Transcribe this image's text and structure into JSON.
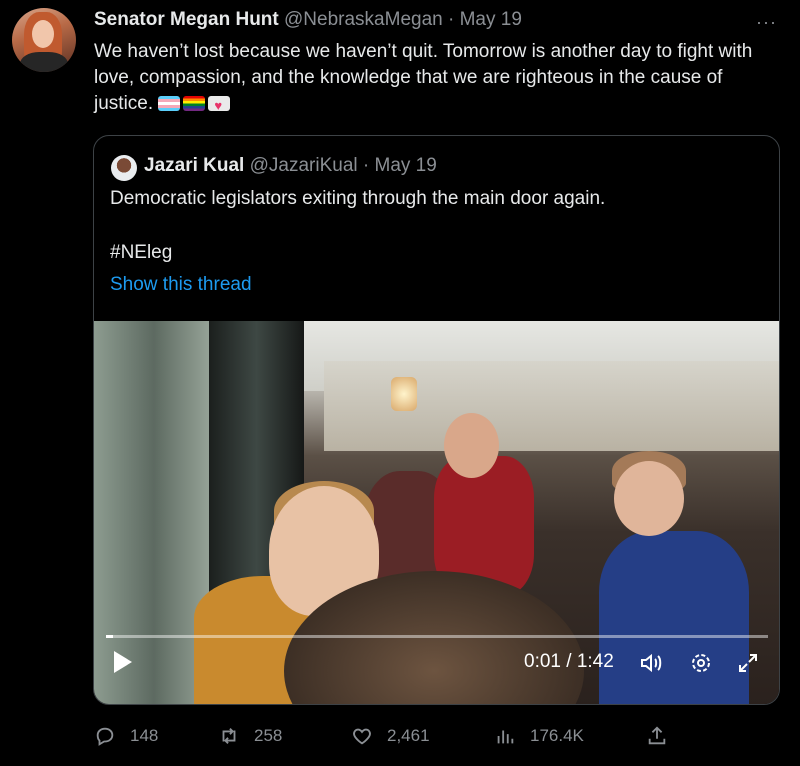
{
  "tweet": {
    "author_name": "Senator Megan Hunt",
    "author_handle": "@NebraskaMegan",
    "separator": "·",
    "date": "May 19",
    "more": "···",
    "text": "We haven’t lost because we haven’t quit. Tomorrow is another day to fight with love, compassion, and the knowledge that we are righteous in the cause of justice."
  },
  "quote": {
    "author_name": "Jazari Kual",
    "author_handle": "@JazariKual",
    "separator": "·",
    "date": "May 19",
    "text": "Democratic legislators exiting through the main door again.",
    "hashtag": "#NEleg",
    "thread_link": "Show this thread"
  },
  "video": {
    "time": "0:01 / 1:42",
    "progress": 0.01
  },
  "actions": {
    "replies": "148",
    "retweets": "258",
    "likes": "2,461",
    "views": "176.4K"
  },
  "colors": {
    "background": "#000000",
    "text": "#e7e9ea",
    "muted": "#8b8f94",
    "link": "#1d9bf0",
    "border": "#3d4246"
  },
  "icons": [
    "reply-icon",
    "retweet-icon",
    "like-icon",
    "views-icon",
    "share-icon",
    "play-icon",
    "volume-icon",
    "settings-icon",
    "fullscreen-icon"
  ]
}
